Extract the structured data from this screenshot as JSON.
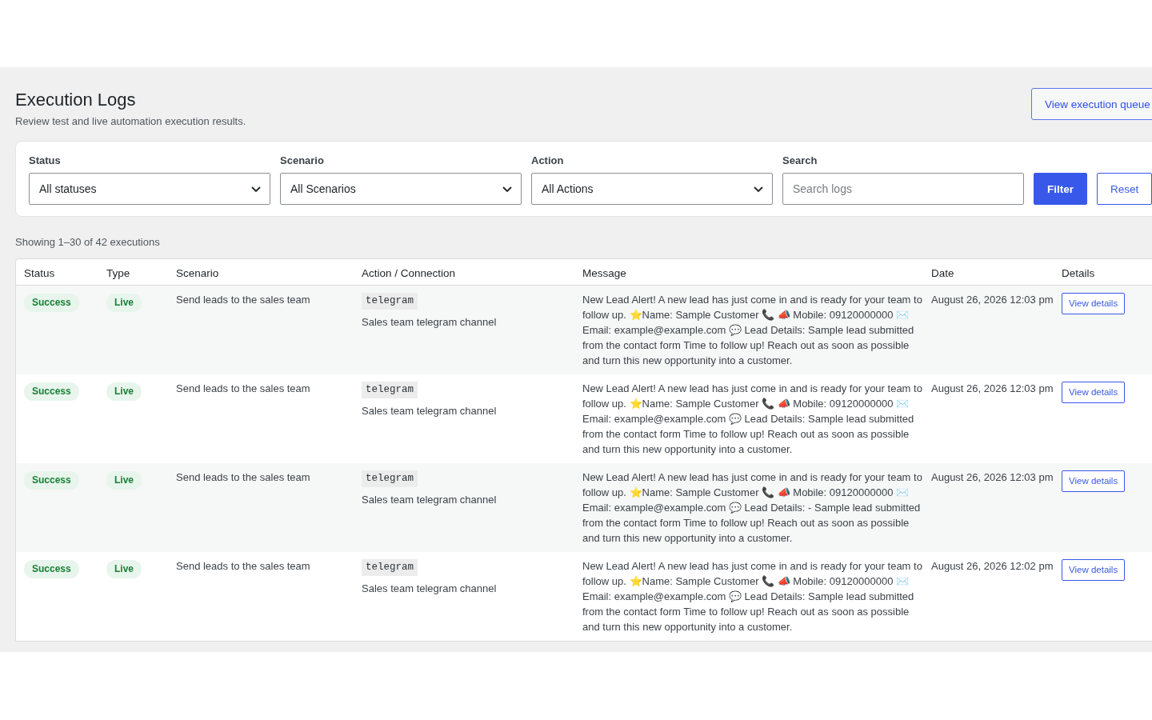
{
  "header": {
    "title": "Execution Logs",
    "subtitle": "Review test and live automation execution results.",
    "queue_button": "View execution queue"
  },
  "filters": {
    "fields": [
      {
        "kind": "select",
        "label": "Status",
        "value": "All statuses"
      },
      {
        "kind": "select",
        "label": "Scenario",
        "value": "All Scenarios"
      },
      {
        "kind": "select",
        "label": "Action",
        "value": "All Actions"
      },
      {
        "kind": "text",
        "label": "Search",
        "placeholder": "Search logs"
      }
    ],
    "buttons": [
      {
        "kind": "primary",
        "label": "Filter"
      },
      {
        "kind": "secondary",
        "label": "Reset"
      }
    ]
  },
  "summary": "Showing 1–30 of 42 executions",
  "table": {
    "columns": [
      "Status",
      "Type",
      "Scenario",
      "Action / Connection",
      "Message",
      "Date",
      "Details"
    ],
    "rows": [
      {
        "status": {
          "text": "Success",
          "kind": "success"
        },
        "type": {
          "text": "Live",
          "kind": "live"
        },
        "scenario": "Send leads to the sales team",
        "action": "telegram",
        "connection": "Sales team telegram channel",
        "message": "New Lead Alert! A new lead has just come in and is ready for your team to follow up. ⭐Name: Sample Customer 📞 📣 Mobile: 09120000000 ✉️ Email: example@example.com 💬 Lead Details: Sample lead submitted from the contact form Time to follow up! Reach out as soon as possible and turn this new opportunity into a customer.",
        "date": "August 26, 2026 12:03 pm",
        "details": "View details"
      },
      {
        "status": {
          "text": "Success",
          "kind": "success"
        },
        "type": {
          "text": "Live",
          "kind": "live"
        },
        "scenario": "Send leads to the sales team",
        "action": "telegram",
        "connection": "Sales team telegram channel",
        "message": "New Lead Alert! A new lead has just come in and is ready for your team to follow up. ⭐Name: Sample Customer 📞 📣 Mobile: 09120000000 ✉️ Email: example@example.com 💬 Lead Details: Sample lead submitted from the contact form Time to follow up! Reach out as soon as possible and turn this new opportunity into a customer.",
        "date": "August 26, 2026 12:03 pm",
        "details": "View details"
      },
      {
        "status": {
          "text": "Success",
          "kind": "success"
        },
        "type": {
          "text": "Live",
          "kind": "live"
        },
        "scenario": "Send leads to the sales team",
        "action": "telegram",
        "connection": "Sales team telegram channel",
        "message": "New Lead Alert! A new lead has just come in and is ready for your team to follow up. ⭐Name: Sample Customer 📞 📣 Mobile: 09120000000 ✉️ Email: example@example.com 💬 Lead Details: - Sample lead submitted from the contact form Time to follow up! Reach out as soon as possible and turn this new opportunity into a customer.",
        "date": "August 26, 2026 12:03 pm",
        "details": "View details"
      },
      {
        "status": {
          "text": "Success",
          "kind": "success"
        },
        "type": {
          "text": "Live",
          "kind": "live"
        },
        "scenario": "Send leads to the sales team",
        "action": "telegram",
        "connection": "Sales team telegram channel",
        "message": "New Lead Alert! A new lead has just come in and is ready for your team to follow up. ⭐Name: Sample Customer 📞 📣 Mobile: 09120000000 ✉️ Email: example@example.com 💬 Lead Details: Sample lead submitted from the contact form Time to follow up! Reach out as soon as possible and turn this new opportunity into a customer.",
        "date": "August 26, 2026 12:02 pm",
        "details": "View details"
      }
    ]
  }
}
